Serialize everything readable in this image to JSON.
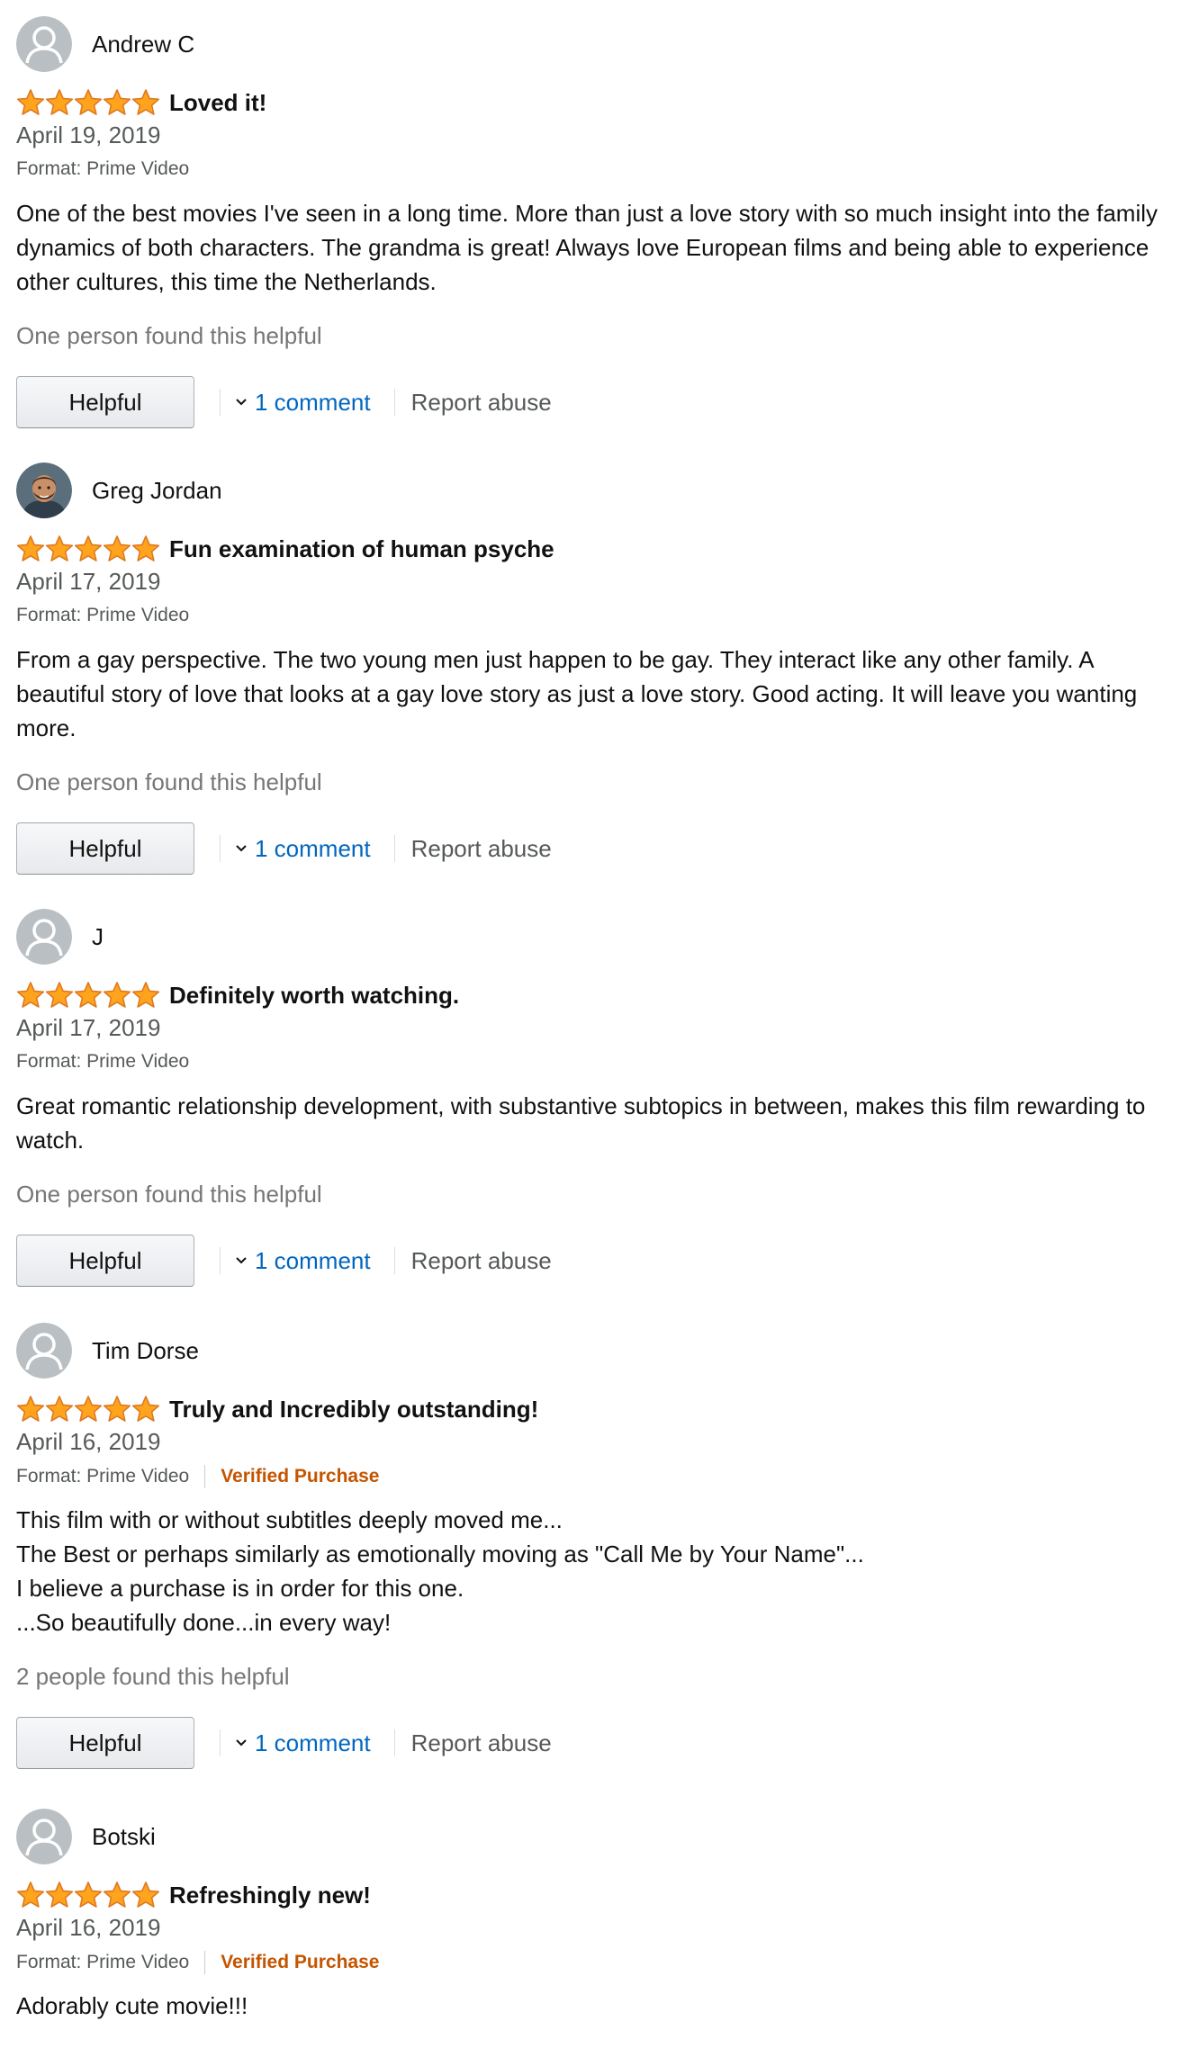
{
  "reviews": [
    {
      "name": "Andrew C",
      "avatar": "default-avatar",
      "stars": 5,
      "title": "Loved it!",
      "date": "April 19, 2019",
      "format": "Format: Prime Video",
      "verified": "",
      "body": [
        "One of the best movies I've seen in a long time. More than just a love story with so much insight into the family dynamics of both characters. The grandma is great! Always love European films and being able to experience other cultures, this time the Netherlands."
      ],
      "helpful_text": "One person found this helpful",
      "helpful_label": "Helpful",
      "comment_label": "1 comment",
      "report_label": "Report abuse"
    },
    {
      "name": "Greg Jordan",
      "avatar": "photo-avatar",
      "stars": 5,
      "title": "Fun examination of human psyche",
      "date": "April 17, 2019",
      "format": "Format: Prime Video",
      "verified": "",
      "body": [
        "From a gay perspective. The two young men just happen to be gay. They interact like any other family. A beautiful story of love that looks at a gay love story as just a love story. Good acting. It will leave you wanting more."
      ],
      "helpful_text": "One person found this helpful",
      "helpful_label": "Helpful",
      "comment_label": "1 comment",
      "report_label": "Report abuse"
    },
    {
      "name": "J",
      "avatar": "default-avatar",
      "stars": 5,
      "title": "Definitely worth watching.",
      "date": "April 17, 2019",
      "format": "Format: Prime Video",
      "verified": "",
      "body": [
        "Great romantic relationship development, with substantive subtopics in between, makes this film rewarding to watch."
      ],
      "helpful_text": "One person found this helpful",
      "helpful_label": "Helpful",
      "comment_label": "1 comment",
      "report_label": "Report abuse"
    },
    {
      "name": "Tim Dorse",
      "avatar": "default-avatar",
      "stars": 5,
      "title": "Truly and Incredibly outstanding!",
      "date": "April 16, 2019",
      "format": "Format: Prime Video",
      "verified": "Verified Purchase",
      "body": [
        "This film with or without subtitles deeply moved me...",
        "The Best or perhaps similarly as emotionally moving as \"Call Me by Your Name\"...",
        "I believe a purchase is in order for this one.",
        "...So beautifully done...in every way!"
      ],
      "helpful_text": "2 people found this helpful",
      "helpful_label": "Helpful",
      "comment_label": "1 comment",
      "report_label": "Report abuse"
    },
    {
      "name": "Botski",
      "avatar": "default-avatar",
      "stars": 5,
      "title": "Refreshingly new!",
      "date": "April 16, 2019",
      "format": "Format: Prime Video",
      "verified": "Verified Purchase",
      "body": [
        "Adorably cute movie!!!"
      ],
      "helpful_text": "",
      "helpful_label": "",
      "comment_label": "",
      "report_label": ""
    }
  ],
  "colors": {
    "star_fill": "#ffa41c",
    "star_stroke": "#de7921",
    "link": "#0066c0",
    "verified": "#c45500",
    "muted_text": "#565959",
    "helpful_text": "#767676"
  }
}
